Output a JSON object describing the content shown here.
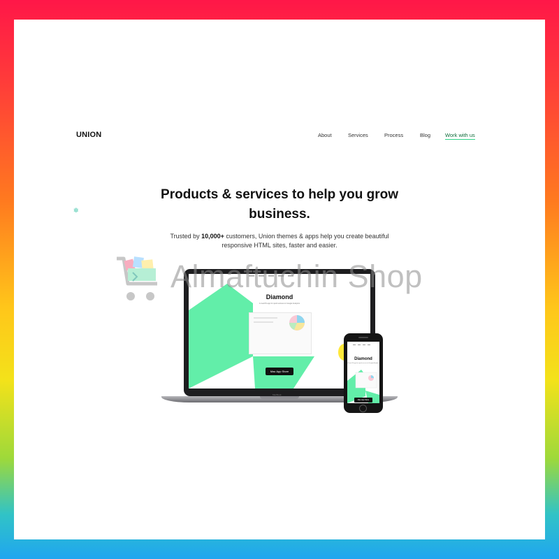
{
  "site": {
    "logo": "UNION",
    "nav": [
      {
        "label": "About"
      },
      {
        "label": "Services"
      },
      {
        "label": "Process"
      },
      {
        "label": "Blog"
      }
    ],
    "cta": "Work with us"
  },
  "hero": {
    "title_line1": "Products & services to help you grow",
    "title_line2": "business.",
    "sub_prefix": "Trusted by ",
    "sub_bold": "10,000+",
    "sub_suffix": " customers, Union themes & apps help you create beautiful",
    "sub_line2": "responsive HTML sites, faster and easier."
  },
  "mockup": {
    "laptop_title": "Diamond",
    "laptop_sub": "A macOS app for quick access to Google Analytics",
    "laptop_badge": "Mac App Store",
    "laptop_brand": "MacBook",
    "phone_title": "Diamond",
    "phone_sub": "A macOS app for quick access to Google Analytics",
    "phone_badge": "Mac App Store"
  },
  "watermark": {
    "text": "Almaftuchin Shop"
  },
  "colors": {
    "accent_green": "#5ff0ac",
    "cta_underline": "#2fd487",
    "frame_gradient_top": "#ff1748",
    "frame_gradient_bottom": "#1fa6f0"
  },
  "icons": {
    "decor": "gear-icon",
    "watermark": "shopping-cart-icon",
    "app_store": "apple-icon"
  }
}
